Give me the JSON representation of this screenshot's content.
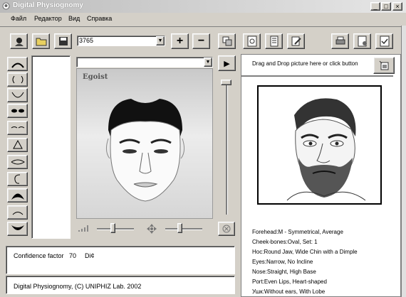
{
  "window": {
    "title": "Digital Physiognomy",
    "minimize": "_",
    "maximize": "□",
    "close": "×"
  },
  "menu": [
    "Файл",
    "Редактор",
    "Вид",
    "Справка"
  ],
  "toolbar": {
    "combo_value": "3765",
    "plus_label": "+",
    "minus_label": "−"
  },
  "features": [
    "forehead",
    "cheek-bones",
    "jaw",
    "eyes",
    "eyebrows",
    "nose",
    "lips",
    "ear",
    "hair",
    "chin",
    "beard"
  ],
  "face_panel": {
    "label": "Egoist",
    "dropdown_value": "",
    "play_label": "▶"
  },
  "right_panel": {
    "drag_hint": "Drag and Drop picture here or click button"
  },
  "description": [
    "Forehead:M - Symmetrical, Average",
    "Cheek-bones:Oval, Set: 1",
    "Hoc:Round Jaw, Wide Chin with a Dimple",
    "Eyes:Narrow, No Incline",
    "Nose:Straight, High Base",
    "Port:Even Lips, Heart-shaped",
    "Ушк:Without ears, With Lobe"
  ],
  "status": {
    "confidence_label": "Confidence factor",
    "confidence_value": "70",
    "confidence_extra": "Di¢",
    "copyright": "Digital Physiognomy, (C) UNIPHIZ Lab. 2002"
  }
}
